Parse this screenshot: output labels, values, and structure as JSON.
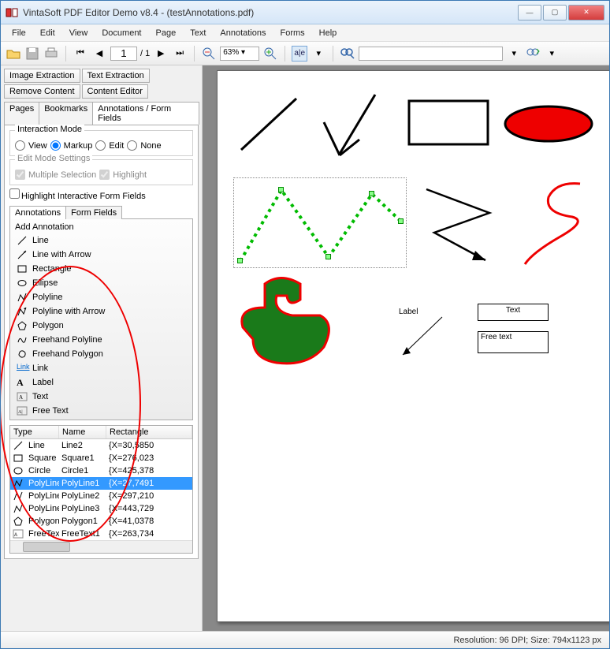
{
  "window": {
    "title": "VintaSoft PDF Editor Demo v8.4  -  (testAnnotations.pdf)"
  },
  "menu": [
    "File",
    "Edit",
    "View",
    "Document",
    "Page",
    "Text",
    "Annotations",
    "Forms",
    "Help"
  ],
  "toolbar": {
    "page_current": "1",
    "page_total": "/ 1",
    "zoom": "63%"
  },
  "side": {
    "top_buttons_row1": [
      "Image Extraction",
      "Text Extraction"
    ],
    "top_buttons_row2": [
      "Remove Content",
      "Content Editor"
    ],
    "top_tabs": [
      "Pages",
      "Bookmarks",
      "Annotations / Form Fields"
    ],
    "interaction_mode": {
      "title": "Interaction Mode",
      "opts": [
        "View",
        "Markup",
        "Edit",
        "None"
      ]
    },
    "edit_mode": {
      "title": "Edit Mode Settings",
      "opts": [
        "Multiple Selection",
        "Highlight"
      ]
    },
    "highlight_fields": "Highlight Interactive Form  Fields",
    "subtabs": [
      "Annotations",
      "Form Fields"
    ],
    "add_annotation_header": "Add Annotation",
    "annotations": [
      "Line",
      "Line with Arrow",
      "Rectangle",
      "Ellipse",
      "Polyline",
      "Polyline with Arrow",
      "Polygon",
      "Freehand Polyline",
      "Freehand Polygon",
      "Link",
      "Label",
      "Text",
      "Free Text"
    ],
    "table_headers": [
      "Type",
      "Name",
      "Rectangle"
    ],
    "table_rows": [
      {
        "type": "Line",
        "name": "Line2",
        "rect": "{X=30,5850"
      },
      {
        "type": "Square",
        "name": "Square1",
        "rect": "{X=276,023"
      },
      {
        "type": "Circle",
        "name": "Circle1",
        "rect": "{X=425,378"
      },
      {
        "type": "PolyLine",
        "name": "PolyLine1",
        "rect": "{X=27,7491",
        "sel": true
      },
      {
        "type": "PolyLine",
        "name": "PolyLine2",
        "rect": "{X=297,210"
      },
      {
        "type": "PolyLine",
        "name": "PolyLine3",
        "rect": "{X=443,729"
      },
      {
        "type": "Polygon",
        "name": "Polygon1",
        "rect": "{X=41,0378"
      },
      {
        "type": "FreeText",
        "name": "FreeText1",
        "rect": "{X=263,734"
      }
    ]
  },
  "canvas": {
    "label_text": "Label",
    "text_box": "Text",
    "freetext_box": "Free text"
  },
  "status": {
    "text": "Resolution: 96 DPI; Size: 794x1123 px"
  }
}
